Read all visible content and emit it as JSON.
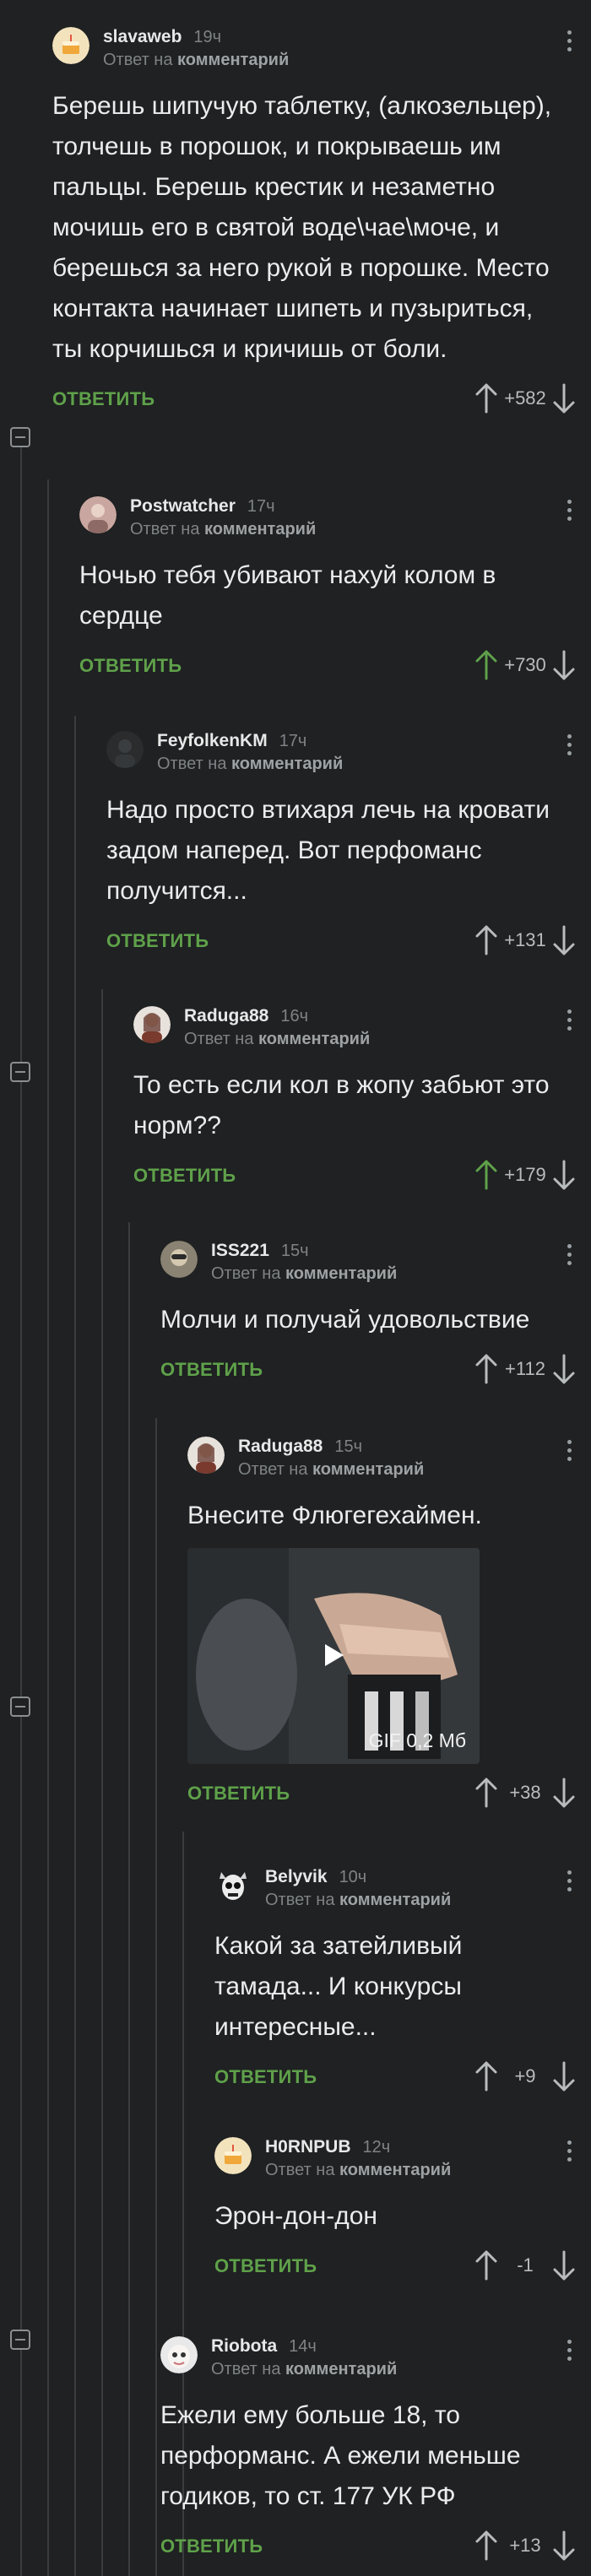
{
  "labels": {
    "reply_prefix": "Ответ на",
    "reply_target": "комментарий",
    "answer": "ОТВЕТИТЬ"
  },
  "colors": {
    "background": "#1f2122",
    "answer_green": "#5fa14a",
    "upvote_active": "#5fa14a"
  },
  "comments": [
    {
      "author": "slavaweb",
      "time": "19ч",
      "text": "Берешь шипучую таблетку, (алкозельцер), толчешь в порошок, и покрываешь им пальцы. Берешь крестик и незаметно мочишь его в святой воде\\чае\\моче, и берешься за него рукой в порошке. Место контакта начинает шипеть и пузыриться, ты корчишься и кричишь от боли.",
      "votes": "+582",
      "upvoted": false,
      "avatar_icon": "cake-avatar-icon"
    },
    {
      "author": "Postwatcher",
      "time": "17ч",
      "text": "Ночью тебя убивают нахуй колом в сердце",
      "votes": "+730",
      "upvoted": true,
      "avatar_icon": "photo-avatar-icon"
    },
    {
      "author": "FeyfolkenKM",
      "time": "17ч",
      "text": "Надо просто втихаря лечь на кровати задом наперед. Вот перфоманс получится...",
      "votes": "+131",
      "upvoted": false,
      "avatar_icon": "dark-avatar-icon"
    },
    {
      "author": "Raduga88",
      "time": "16ч",
      "text": "То есть если кол в жопу забьют это норм??",
      "votes": "+179",
      "upvoted": true,
      "avatar_icon": "portrait-avatar-icon"
    },
    {
      "author": "ISS221",
      "time": "15ч",
      "text": "Молчи и получай удовольствие",
      "votes": "+112",
      "upvoted": false,
      "avatar_icon": "photo-avatar-icon"
    },
    {
      "author": "Raduga88",
      "time": "15ч",
      "text": "Внесите Флюгегехаймен.",
      "votes": "+38",
      "upvoted": false,
      "avatar_icon": "portrait-avatar-icon",
      "media": {
        "label": "GIF 0,2 Мб",
        "icon": "play-icon"
      }
    },
    {
      "author": "Belyvik",
      "time": "10ч",
      "text": "Какой за затейливый тамада... И конкурсы интересные...",
      "votes": "+9",
      "upvoted": false,
      "avatar_icon": "skull-avatar-icon"
    },
    {
      "author": "H0RNPUB",
      "time": "12ч",
      "text": "Эрон-дон-дон",
      "votes": "-1",
      "upvoted": false,
      "avatar_icon": "cake-avatar-icon"
    },
    {
      "author": "Riobota",
      "time": "14ч",
      "text": "Ежели ему больше 18, то перформанс. А ежели меньше годиков, то ст. 177 УК РФ",
      "votes": "+13",
      "upvoted": false,
      "avatar_icon": "face-avatar-icon"
    }
  ]
}
